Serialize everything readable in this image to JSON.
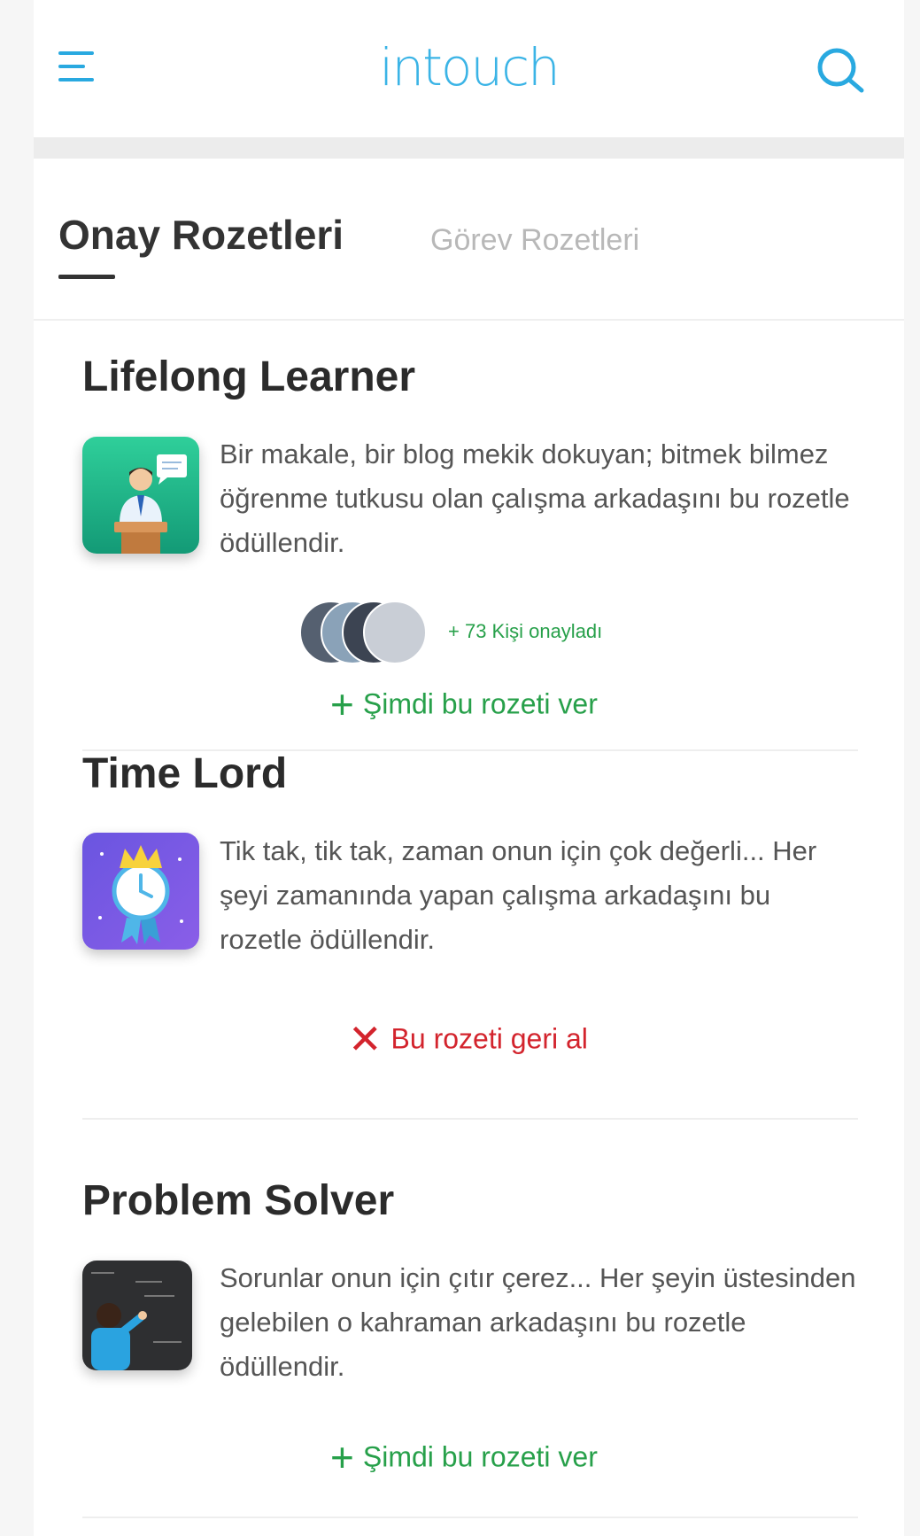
{
  "header": {
    "logo_text": "intouch",
    "menu_icon": "hamburger-menu-icon",
    "search_icon": "search-icon",
    "brand_color": "#29a9e0"
  },
  "tabs": [
    {
      "label": "Onay Rozetleri",
      "active": true
    },
    {
      "label": "Görev Rozetleri",
      "active": false
    }
  ],
  "badges": [
    {
      "title": "Lifelong Learner",
      "description": "Bir makale, bir blog mekik dokuyan; bitmek bilmez öğrenme tutkusu olan çalışma arkadaşını bu rozetle ödüllendir.",
      "icon": "teacher-podium-icon",
      "approved_text": "+ 73 Kişi onayladı",
      "action_label": "Şimdi bu rozeti ver",
      "action_icon": "plus-icon",
      "action_type": "give"
    },
    {
      "title": "Time Lord",
      "description": "Tik tak, tik tak, zaman onun için çok değerli... Her şeyi zamanında yapan çalışma arkadaşını bu rozetle ödüllendir.",
      "icon": "crowned-clock-icon",
      "action_label": "Bu rozeti geri al",
      "action_icon": "close-x-icon",
      "action_type": "revoke"
    },
    {
      "title": "Problem Solver",
      "description": "Sorunlar onun için çıtır çerez... Her şeyin üstesinden gelebilen o kahraman arkadaşını bu rozetle ödüllendir.",
      "icon": "chalkboard-student-icon",
      "action_label": "Şimdi bu rozeti ver",
      "action_icon": "plus-icon",
      "action_type": "give"
    }
  ],
  "colors": {
    "give": "#27a04a",
    "revoke": "#d3242d",
    "title": "#2b2b2b",
    "body_text": "#555555"
  }
}
